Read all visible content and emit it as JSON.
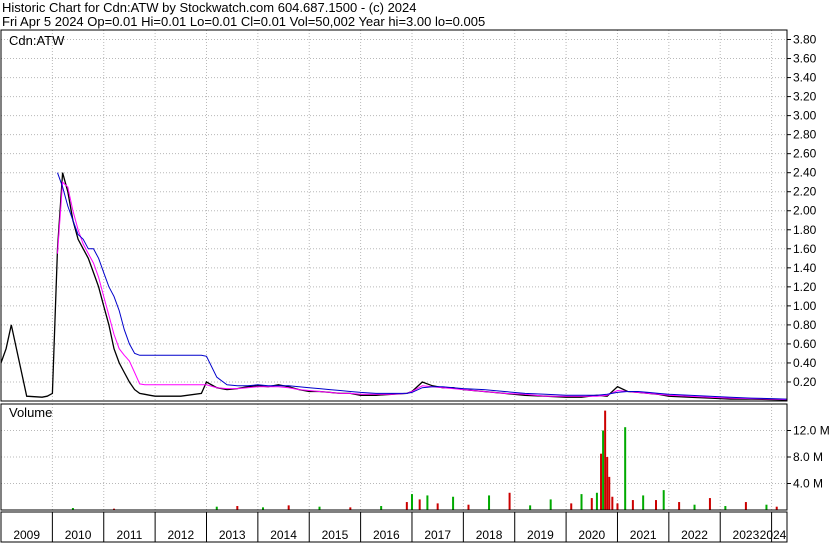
{
  "header": {
    "title": "Historic Chart for Cdn:ATW by Stockwatch.com 604.687.1500 - (c) 2024",
    "summary": "Fri Apr  5 2024   Op=0.01   Hi=0.01   Lo=0.01   Cl=0.01   Vol=50,002   Year hi=3.00   lo=0.005"
  },
  "colors": {
    "price": "#000000",
    "down": "#cc0000",
    "ma_short": "#ff00ff",
    "ma_long": "#0000cc",
    "vol_up": "#00aa00",
    "vol_down": "#cc0000",
    "grid": "#b8b8b8"
  },
  "chart_data": [
    {
      "type": "line",
      "title": "Cdn:ATW",
      "ylim": [
        0,
        3.9
      ],
      "y_ticks": [
        "3.80",
        "3.60",
        "3.40",
        "3.20",
        "3.00",
        "2.80",
        "2.60",
        "2.40",
        "2.20",
        "2.00",
        "1.80",
        "1.60",
        "1.40",
        "1.20",
        "1.00",
        "0.80",
        "0.60",
        "0.40",
        "0.20"
      ],
      "x_ticks": [
        "2009",
        "2010",
        "2011",
        "2012",
        "2013",
        "2014",
        "2015",
        "2016",
        "2017",
        "2018",
        "2019",
        "2020",
        "2021",
        "2022",
        "2023",
        "2024"
      ],
      "xlim": [
        2009.0,
        2024.3
      ],
      "series": [
        {
          "role": "price",
          "x": [
            2009.0,
            2009.1,
            2009.2,
            2009.5,
            2009.8,
            2009.9,
            2010.0,
            2010.1,
            2010.2,
            2010.3,
            2010.4,
            2010.5,
            2010.6,
            2010.7,
            2010.8,
            2010.9,
            2011.0,
            2011.1,
            2011.2,
            2011.3,
            2011.4,
            2011.5,
            2011.6,
            2011.7,
            2011.8,
            2011.9,
            2012.0,
            2012.5,
            2012.9,
            2013.0,
            2013.2,
            2013.4,
            2013.6,
            2013.8,
            2014.0,
            2014.2,
            2014.4,
            2014.6,
            2014.8,
            2015.0,
            2015.2,
            2015.4,
            2015.6,
            2015.8,
            2016.0,
            2016.3,
            2016.6,
            2016.9,
            2017.0,
            2017.2,
            2017.4,
            2017.6,
            2017.8,
            2018.0,
            2018.4,
            2018.8,
            2019.2,
            2019.6,
            2020.0,
            2020.3,
            2020.6,
            2020.8,
            2021.0,
            2021.2,
            2021.4,
            2021.6,
            2021.8,
            2022.0,
            2022.4,
            2022.8,
            2023.2,
            2023.6,
            2024.0,
            2024.3
          ],
          "y": [
            0.4,
            0.55,
            0.8,
            0.05,
            0.04,
            0.05,
            0.08,
            1.6,
            2.4,
            2.2,
            1.9,
            1.7,
            1.6,
            1.5,
            1.35,
            1.2,
            1.0,
            0.8,
            0.55,
            0.4,
            0.3,
            0.2,
            0.12,
            0.08,
            0.07,
            0.06,
            0.05,
            0.05,
            0.08,
            0.2,
            0.14,
            0.12,
            0.13,
            0.15,
            0.16,
            0.15,
            0.17,
            0.15,
            0.12,
            0.1,
            0.1,
            0.09,
            0.08,
            0.08,
            0.06,
            0.06,
            0.07,
            0.08,
            0.1,
            0.2,
            0.16,
            0.14,
            0.14,
            0.12,
            0.1,
            0.08,
            0.06,
            0.05,
            0.04,
            0.04,
            0.06,
            0.05,
            0.15,
            0.1,
            0.09,
            0.08,
            0.07,
            0.05,
            0.04,
            0.03,
            0.02,
            0.02,
            0.015,
            0.01
          ]
        },
        {
          "role": "ma_short",
          "x": [
            2010.1,
            2010.2,
            2010.3,
            2010.4,
            2010.5,
            2010.6,
            2010.7,
            2010.8,
            2010.9,
            2011.0,
            2011.1,
            2011.2,
            2011.3,
            2011.4,
            2011.5,
            2011.6,
            2011.7,
            2011.8,
            2011.9,
            2012.0,
            2012.5,
            2012.9,
            2013.0,
            2013.2,
            2013.4,
            2013.6,
            2013.8,
            2014.0,
            2014.2,
            2014.4,
            2014.6,
            2014.8,
            2015.0,
            2015.2,
            2015.4,
            2015.6,
            2015.8,
            2016.0,
            2016.3,
            2016.6,
            2016.9,
            2017.0,
            2017.2,
            2017.4,
            2017.6,
            2017.8,
            2018.0,
            2018.4,
            2018.8,
            2019.2,
            2019.6,
            2020.0,
            2020.3,
            2020.6,
            2020.8,
            2021.0,
            2021.2,
            2021.4,
            2021.6,
            2021.8,
            2022.0,
            2022.4,
            2022.8,
            2023.2,
            2023.6,
            2024.0,
            2024.3
          ],
          "y": [
            1.55,
            2.3,
            2.25,
            2.0,
            1.8,
            1.65,
            1.55,
            1.45,
            1.3,
            1.1,
            0.9,
            0.7,
            0.55,
            0.48,
            0.42,
            0.3,
            0.18,
            0.17,
            0.17,
            0.17,
            0.17,
            0.17,
            0.17,
            0.14,
            0.13,
            0.13,
            0.14,
            0.15,
            0.15,
            0.15,
            0.14,
            0.12,
            0.11,
            0.1,
            0.09,
            0.08,
            0.08,
            0.07,
            0.07,
            0.07,
            0.08,
            0.1,
            0.16,
            0.15,
            0.14,
            0.13,
            0.12,
            0.1,
            0.08,
            0.07,
            0.05,
            0.05,
            0.05,
            0.05,
            0.06,
            0.11,
            0.1,
            0.09,
            0.08,
            0.07,
            0.06,
            0.05,
            0.04,
            0.03,
            0.025,
            0.02,
            0.015
          ]
        },
        {
          "role": "ma_long",
          "x": [
            2010.1,
            2010.2,
            2010.3,
            2010.4,
            2010.5,
            2010.6,
            2010.7,
            2010.8,
            2010.9,
            2011.0,
            2011.1,
            2011.2,
            2011.3,
            2011.4,
            2011.5,
            2011.6,
            2011.7,
            2011.8,
            2011.9,
            2012.0,
            2012.5,
            2012.9,
            2013.0,
            2013.2,
            2013.4,
            2013.6,
            2013.8,
            2014.0,
            2014.2,
            2014.4,
            2014.6,
            2014.8,
            2015.0,
            2015.2,
            2015.4,
            2015.6,
            2015.8,
            2016.0,
            2016.3,
            2016.6,
            2016.9,
            2017.0,
            2017.2,
            2017.4,
            2017.6,
            2017.8,
            2018.0,
            2018.4,
            2018.8,
            2019.2,
            2019.6,
            2020.0,
            2020.3,
            2020.6,
            2020.8,
            2021.0,
            2021.2,
            2021.4,
            2021.6,
            2021.8,
            2022.0,
            2022.4,
            2022.8,
            2023.2,
            2023.6,
            2024.0,
            2024.3
          ],
          "y": [
            2.4,
            2.25,
            2.05,
            1.9,
            1.75,
            1.7,
            1.6,
            1.6,
            1.5,
            1.35,
            1.2,
            1.1,
            0.95,
            0.75,
            0.6,
            0.5,
            0.48,
            0.48,
            0.48,
            0.48,
            0.48,
            0.48,
            0.47,
            0.25,
            0.17,
            0.16,
            0.16,
            0.17,
            0.16,
            0.16,
            0.16,
            0.15,
            0.14,
            0.13,
            0.12,
            0.11,
            0.1,
            0.09,
            0.08,
            0.08,
            0.08,
            0.09,
            0.14,
            0.15,
            0.15,
            0.14,
            0.13,
            0.12,
            0.1,
            0.08,
            0.07,
            0.06,
            0.06,
            0.06,
            0.07,
            0.09,
            0.1,
            0.1,
            0.09,
            0.08,
            0.07,
            0.06,
            0.05,
            0.04,
            0.03,
            0.025,
            0.02
          ]
        }
      ]
    },
    {
      "type": "bar",
      "title": "Volume",
      "ylim": [
        0,
        16
      ],
      "y_ticks": [
        "12.0 M",
        "8.0 M",
        "4.0 M"
      ],
      "bars": [
        {
          "x": 2010.4,
          "v": 0.3,
          "up": true
        },
        {
          "x": 2011.2,
          "v": 0.2,
          "up": false
        },
        {
          "x": 2013.2,
          "v": 0.5,
          "up": true
        },
        {
          "x": 2013.6,
          "v": 0.6,
          "up": false
        },
        {
          "x": 2014.1,
          "v": 0.4,
          "up": true
        },
        {
          "x": 2014.6,
          "v": 0.7,
          "up": false
        },
        {
          "x": 2015.2,
          "v": 0.5,
          "up": true
        },
        {
          "x": 2015.8,
          "v": 0.4,
          "up": false
        },
        {
          "x": 2016.4,
          "v": 0.6,
          "up": true
        },
        {
          "x": 2016.9,
          "v": 1.2,
          "up": false
        },
        {
          "x": 2017.0,
          "v": 2.4,
          "up": true
        },
        {
          "x": 2017.15,
          "v": 1.6,
          "up": false
        },
        {
          "x": 2017.3,
          "v": 2.2,
          "up": true
        },
        {
          "x": 2017.5,
          "v": 1.0,
          "up": false
        },
        {
          "x": 2017.8,
          "v": 2.0,
          "up": true
        },
        {
          "x": 2018.1,
          "v": 0.8,
          "up": false
        },
        {
          "x": 2018.5,
          "v": 2.2,
          "up": true
        },
        {
          "x": 2018.9,
          "v": 2.6,
          "up": false
        },
        {
          "x": 2019.3,
          "v": 0.7,
          "up": true
        },
        {
          "x": 2019.7,
          "v": 1.6,
          "up": true
        },
        {
          "x": 2020.1,
          "v": 1.0,
          "up": false
        },
        {
          "x": 2020.3,
          "v": 2.4,
          "up": true
        },
        {
          "x": 2020.5,
          "v": 1.8,
          "up": false
        },
        {
          "x": 2020.6,
          "v": 2.6,
          "up": true
        },
        {
          "x": 2020.68,
          "v": 8.5,
          "up": false
        },
        {
          "x": 2020.72,
          "v": 12.0,
          "up": true
        },
        {
          "x": 2020.76,
          "v": 15.0,
          "up": false
        },
        {
          "x": 2020.8,
          "v": 8.0,
          "up": false
        },
        {
          "x": 2020.84,
          "v": 5.0,
          "up": false
        },
        {
          "x": 2020.9,
          "v": 2.0,
          "up": false
        },
        {
          "x": 2021.0,
          "v": 1.0,
          "up": false
        },
        {
          "x": 2021.15,
          "v": 12.5,
          "up": true
        },
        {
          "x": 2021.3,
          "v": 1.5,
          "up": false
        },
        {
          "x": 2021.5,
          "v": 2.2,
          "up": true
        },
        {
          "x": 2021.75,
          "v": 1.5,
          "up": false
        },
        {
          "x": 2021.9,
          "v": 3.0,
          "up": true
        },
        {
          "x": 2022.2,
          "v": 1.2,
          "up": false
        },
        {
          "x": 2022.5,
          "v": 0.8,
          "up": true
        },
        {
          "x": 2022.8,
          "v": 1.8,
          "up": false
        },
        {
          "x": 2023.1,
          "v": 0.6,
          "up": true
        },
        {
          "x": 2023.5,
          "v": 1.2,
          "up": false
        },
        {
          "x": 2023.9,
          "v": 0.8,
          "up": true
        },
        {
          "x": 2024.1,
          "v": 0.5,
          "up": false
        }
      ]
    }
  ]
}
